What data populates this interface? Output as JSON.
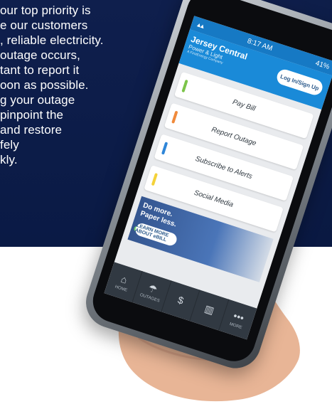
{
  "copy": {
    "lines": [
      " our top priority is",
      "e our customers",
      ", reliable electricity.",
      "outage occurs,",
      "tant to report it",
      "oon as possible.",
      "g your outage",
      "pinpoint the",
      "and restore",
      "fely",
      "kly."
    ]
  },
  "phone": {
    "status_time": "8:17 AM",
    "status_right": "41%",
    "logo_line1": "Jersey Central",
    "logo_line2": "Power & Light",
    "logo_line3": "A FirstEnergy Company",
    "login_button": "Log In/Sign Up",
    "menu": [
      {
        "label": "Pay Bill",
        "accent": "#7cc44a"
      },
      {
        "label": "Report Outage",
        "accent": "#f08a3b"
      },
      {
        "label": "Subscribe to Alerts",
        "accent": "#2f86d8"
      },
      {
        "label": "Social Media",
        "accent": "#f4d23a"
      }
    ],
    "promo": {
      "line1": "Do more.",
      "line2": "Paper less.",
      "button": "LEARN MORE ABOUT eBILL"
    },
    "tabs": [
      {
        "icon": "home-icon",
        "label": "HOME"
      },
      {
        "icon": "bolt-icon",
        "label": "OUTAGES"
      },
      {
        "icon": "dollar-icon",
        "label": ""
      },
      {
        "icon": "bar-chart-icon",
        "label": ""
      },
      {
        "icon": "more-icon",
        "label": "MORE"
      }
    ]
  }
}
